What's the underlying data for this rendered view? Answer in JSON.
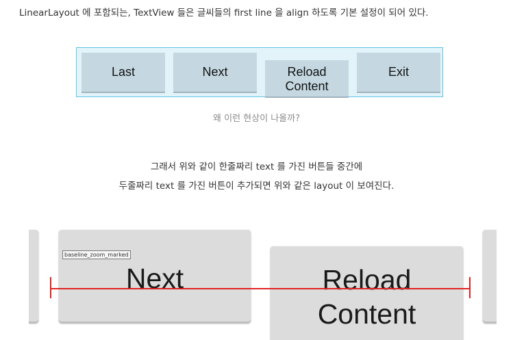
{
  "intro": "LinearLayout 에 포함되는, TextView 들은 글씨들의 first line 을 align 하도록 기본 설정이 되어 있다.",
  "demo": {
    "buttons": [
      {
        "lines": [
          "Last"
        ]
      },
      {
        "lines": [
          "Next"
        ]
      },
      {
        "lines": [
          "Reload",
          "Content"
        ]
      },
      {
        "lines": [
          "Exit"
        ]
      }
    ]
  },
  "caption": "왜 이런 현상이 나올까?",
  "paragraph": {
    "line1": "그래서 위와 같이 한줄짜리 text 를 가진 버튼들 중간에",
    "line2": "두줄짜리 text 를 가진 버튼이 추가되면 위와 같은 layout 이 보여진다."
  },
  "zoom": {
    "tag": "baseline_zoom_marked",
    "next_label": "Next",
    "reload_line1": "Reload",
    "reload_line2": "Content"
  },
  "colors": {
    "demo_background": "#e2f4fa",
    "demo_border": "#5fc4e8",
    "demo_button": "#c5d8e1",
    "zoom_button": "#dcdcdc",
    "baseline": "#e02020"
  }
}
